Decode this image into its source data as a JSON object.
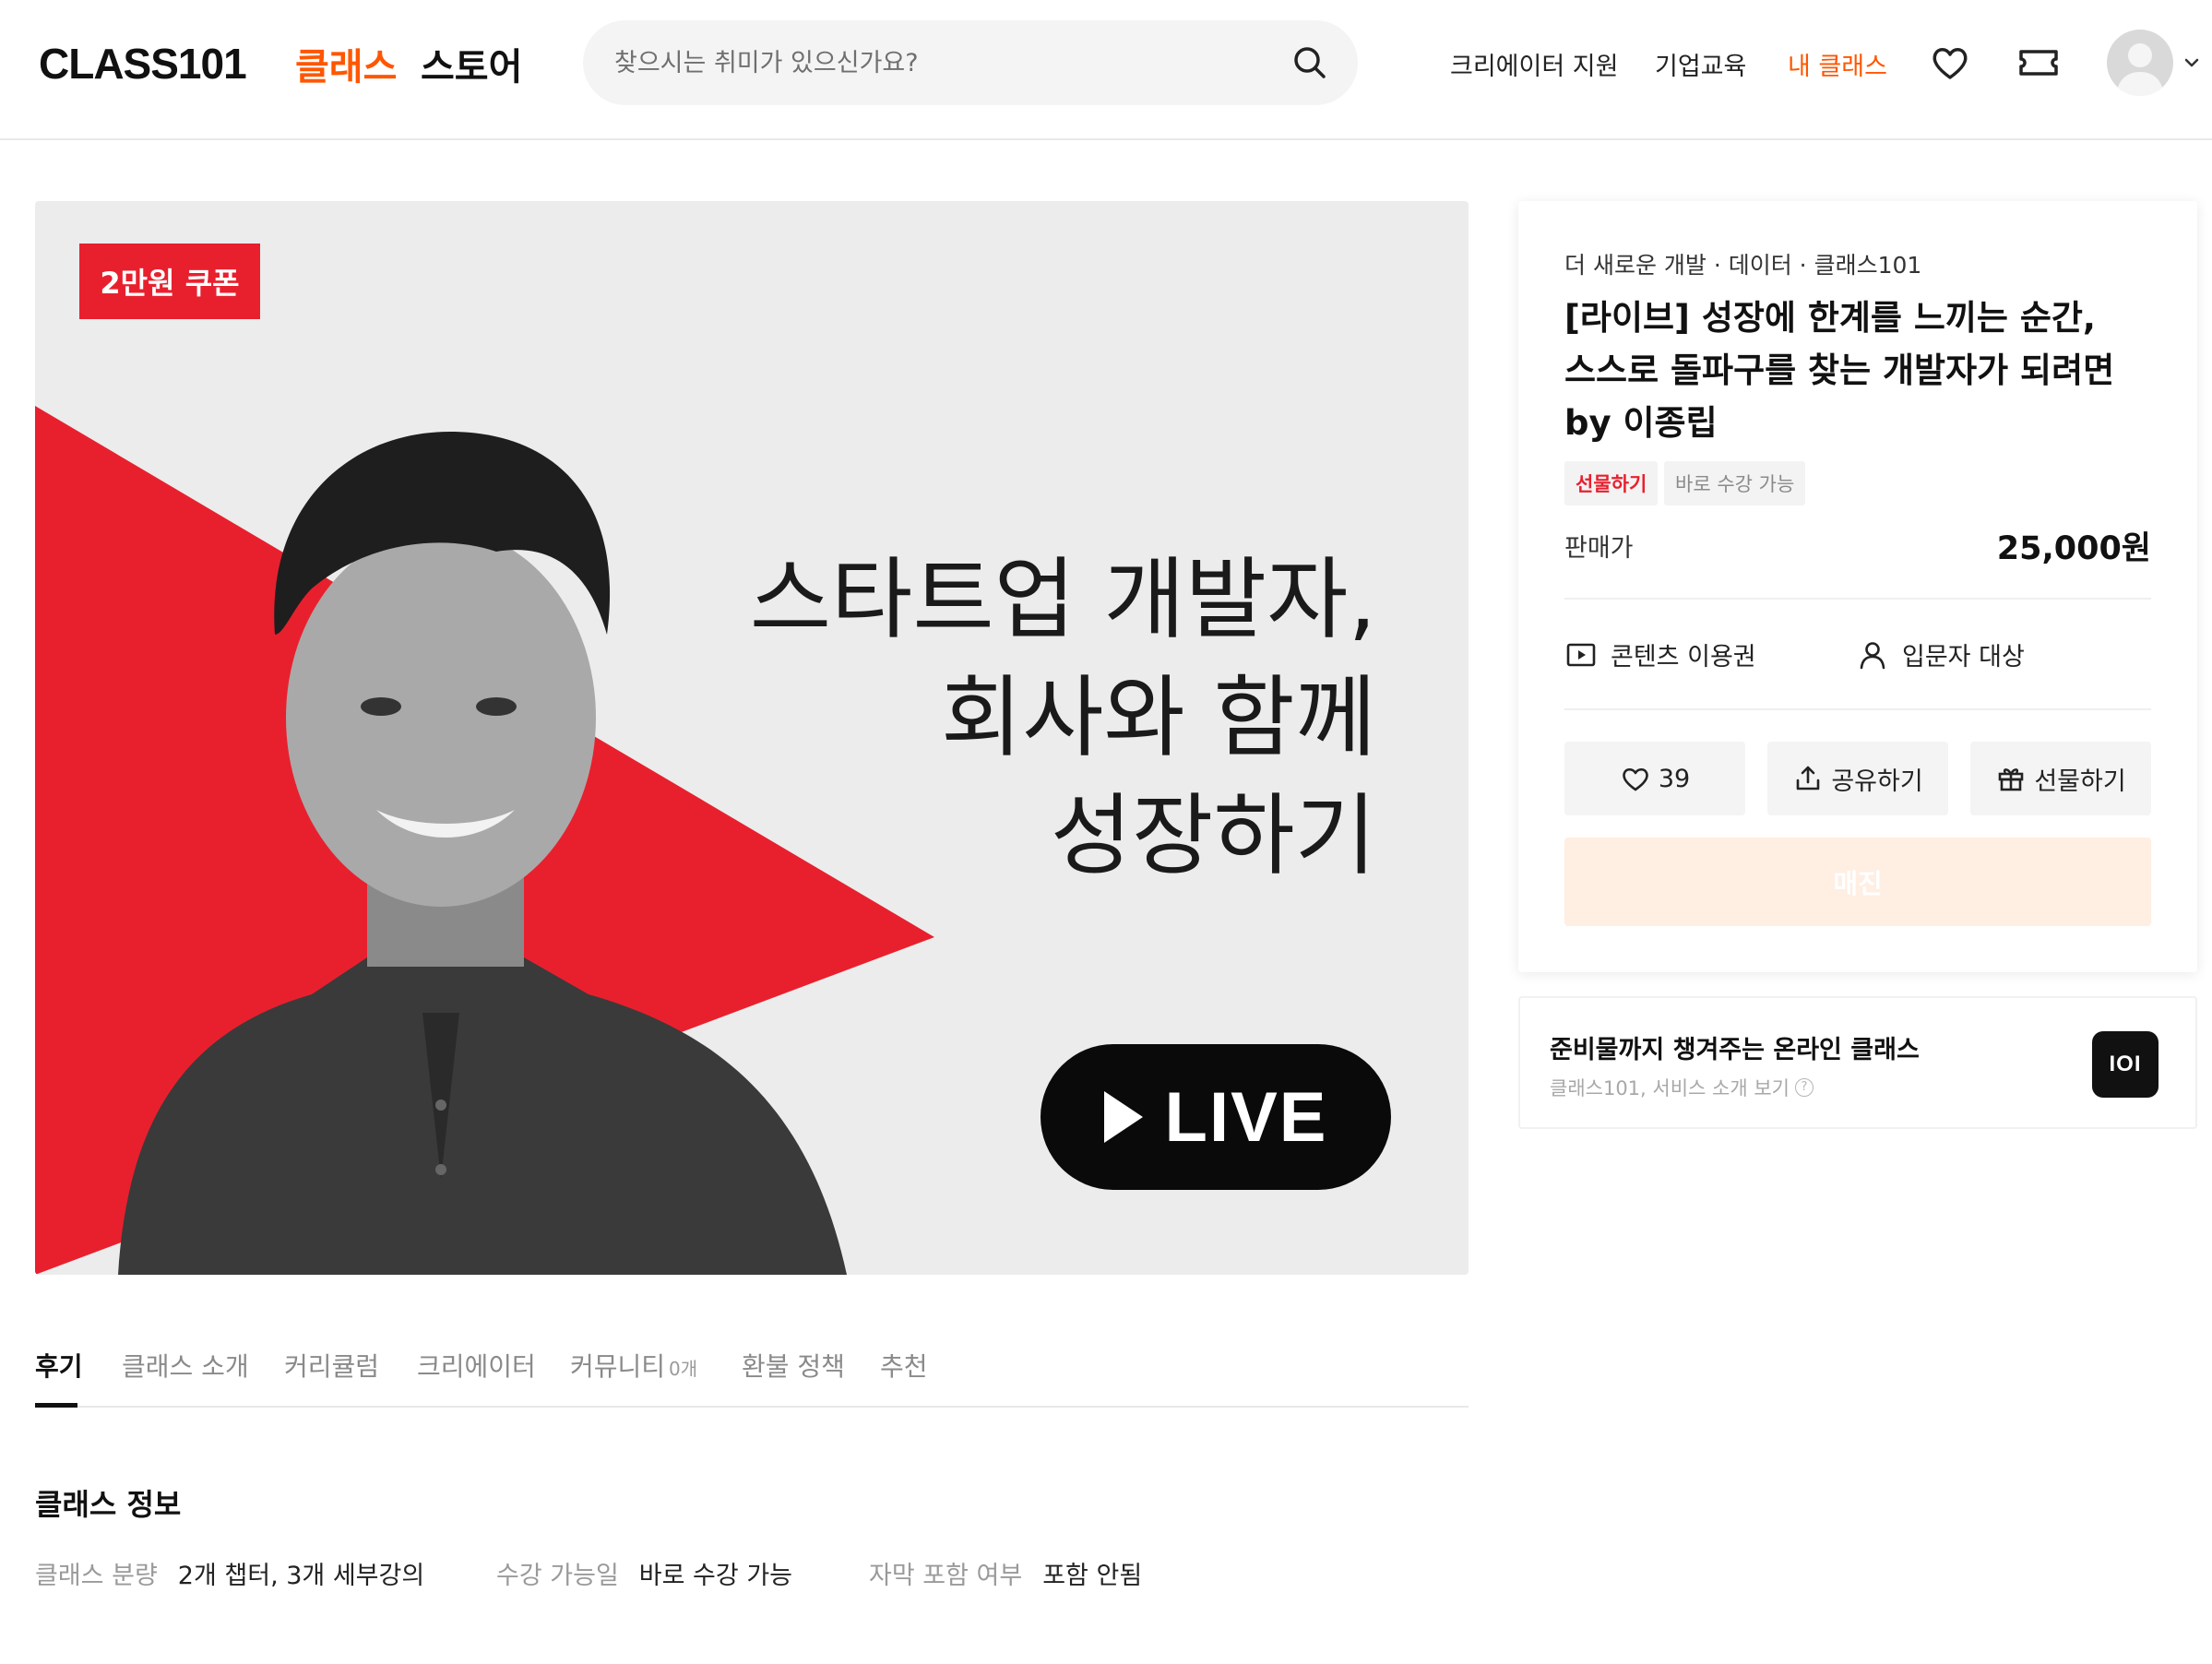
{
  "header": {
    "logo": "CLASS101",
    "nav": {
      "classes": "클래스",
      "store": "스토어"
    },
    "search": {
      "placeholder": "찾으시는 취미가 있으신가요?"
    },
    "links": {
      "creator_support": "크리에이터 지원",
      "corporate_education": "기업교육",
      "my_classes": "내 클래스"
    },
    "icons": [
      "heart-icon",
      "coupon-icon",
      "avatar",
      "chevron-down-icon"
    ]
  },
  "hero": {
    "coupon_badge": "2만원 쿠폰",
    "headline": [
      "스타트업 개발자,",
      "회사와 함께",
      "성장하기"
    ],
    "live_label": "LIVE"
  },
  "tabs": [
    {
      "label": "후기",
      "active": true
    },
    {
      "label": "클래스 소개"
    },
    {
      "label": "커리큘럼"
    },
    {
      "label": "크리에이터"
    },
    {
      "label": "커뮤니티",
      "count": "0개"
    },
    {
      "label": "환불 정책"
    },
    {
      "label": "추천"
    }
  ],
  "class_info": {
    "title": "클래스 정보",
    "items": [
      {
        "label": "클래스 분량",
        "value": "2개 챕터, 3개 세부강의"
      },
      {
        "label": "수강 가능일",
        "value": "바로 수강 가능"
      },
      {
        "label": "자막 포함 여부",
        "value": "포함 안됨"
      }
    ]
  },
  "product": {
    "breadcrumb": "더 새로운 개발 · 데이터 · 클래스101",
    "title_lines": [
      "[라이브] 성장에 한계를 느끼는 순간,",
      "스스로 돌파구를 찾는 개발자가 되려면",
      "by 이종립"
    ],
    "badges": {
      "gift": "선물하기",
      "available": "바로 수강 가능"
    },
    "price_label": "판매가",
    "price": "25,000원",
    "features": {
      "content": "콘텐츠 이용권",
      "level": "입문자 대상"
    },
    "actions": {
      "likes": "39",
      "share": "공유하기",
      "gift": "선물하기"
    },
    "soldout_label": "매진"
  },
  "promo": {
    "title": "준비물까지 챙겨주는 온라인 클래스",
    "subtitle": "클래스101, 서비스 소개 보기",
    "logo_text": "IOI"
  },
  "colors": {
    "accent": "#ff5600",
    "red": "#e8202e",
    "soldout_bg": "#ffeee2"
  }
}
